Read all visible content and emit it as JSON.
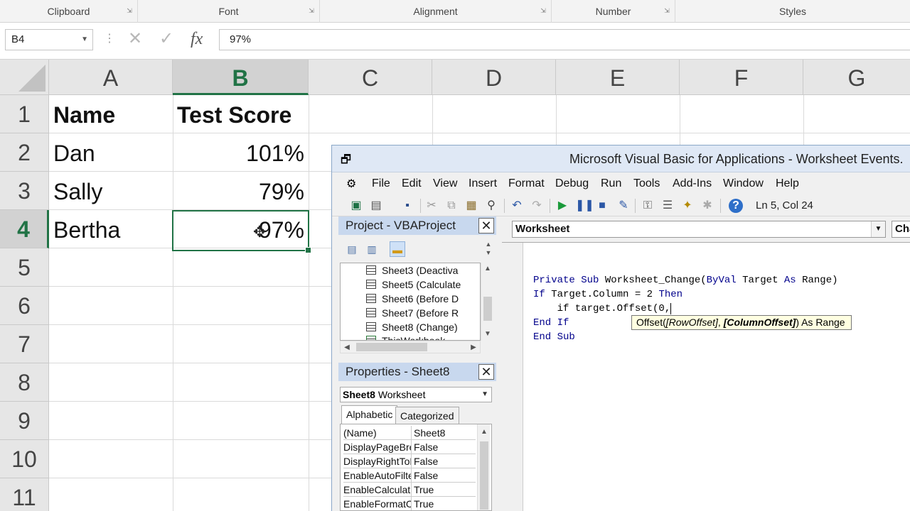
{
  "ribbon": {
    "groups": [
      "Clipboard",
      "Font",
      "Alignment",
      "Number",
      "Styles"
    ]
  },
  "formula_bar": {
    "name_box": "B4",
    "cancel_glyph": "✕",
    "enter_glyph": "✓",
    "fx_label": "fx",
    "value": "97%"
  },
  "sheet": {
    "columns": [
      "A",
      "B",
      "C",
      "D",
      "E",
      "F",
      "G"
    ],
    "rows": [
      "1",
      "2",
      "3",
      "4",
      "5",
      "6",
      "7",
      "8",
      "9",
      "10",
      "11"
    ],
    "cells": {
      "a1": "Name",
      "b1": "Test Score",
      "a2": "Dan",
      "b2": "101%",
      "a3": "Sally",
      "b3": "79%",
      "a4": "Bertha",
      "b4": "97%"
    },
    "accent_color": "#217346"
  },
  "vba": {
    "title": "Microsoft Visual Basic for Applications - Worksheet Events.",
    "menu": [
      "File",
      "Edit",
      "View",
      "Insert",
      "Format",
      "Debug",
      "Run",
      "Tools",
      "Add-Ins",
      "Window",
      "Help"
    ],
    "status": "Ln 5, Col 24",
    "project": {
      "title": "Project - VBAProject",
      "items": [
        "Sheet3 (Deactiva",
        "Sheet5 (Calculate",
        "Sheet6 (Before D",
        "Sheet7 (Before R",
        "Sheet8 (Change)",
        "ThisWorkbook"
      ]
    },
    "properties": {
      "title": "Properties - Sheet8",
      "object_name": "Sheet8",
      "object_type": "Worksheet",
      "tabs": [
        "Alphabetic",
        "Categorized"
      ],
      "rows": [
        {
          "name": "(Name)",
          "value": "Sheet8"
        },
        {
          "name": "DisplayPageBrea",
          "value": "False"
        },
        {
          "name": "DisplayRightToL",
          "value": "False"
        },
        {
          "name": "EnableAutoFilter",
          "value": "False"
        },
        {
          "name": "EnableCalculatic",
          "value": "True"
        },
        {
          "name": "EnableFormatCo",
          "value": "True"
        }
      ]
    },
    "code": {
      "object_combo": "Worksheet",
      "proc_combo": "Cha",
      "lines": [
        {
          "kw1": "Private Sub",
          "text": " Worksheet_Change(",
          "kw2": "ByVal",
          "text2": " Target ",
          "kw3": "As",
          "text3": " Range)"
        },
        {
          "kw1": "If",
          "text": " Target.Column = 2 ",
          "kw2": "Then",
          "text2": "",
          "kw3": "",
          "text3": ""
        },
        {
          "kw1": "",
          "text": "    if target.Offset(0,",
          "kw2": "",
          "text2": "",
          "kw3": "",
          "text3": ""
        },
        {
          "kw1": "End If",
          "text": "",
          "kw2": "",
          "text2": "",
          "kw3": "",
          "text3": ""
        },
        {
          "kw1": "End Sub",
          "text": "",
          "kw2": "",
          "text2": "",
          "kw3": "",
          "text3": ""
        }
      ],
      "tooltip": {
        "prefix": "Offset(",
        "arg1": "[RowOffset]",
        "sep": ", ",
        "arg2": "[ColumnOffset]",
        "suffix": ") As Range"
      }
    }
  }
}
